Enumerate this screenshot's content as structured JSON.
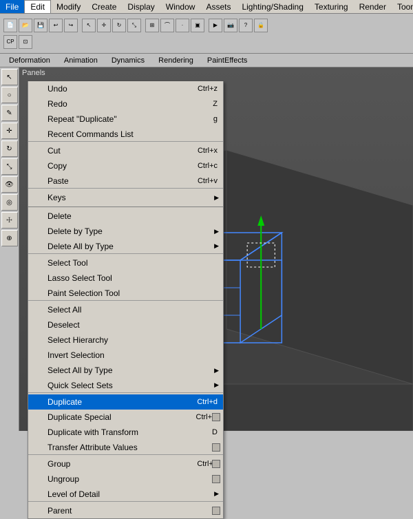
{
  "menubar": {
    "items": [
      {
        "label": "File",
        "id": "file"
      },
      {
        "label": "Edit",
        "id": "edit",
        "active": true
      },
      {
        "label": "Modify",
        "id": "modify"
      },
      {
        "label": "Create",
        "id": "create"
      },
      {
        "label": "Display",
        "id": "display"
      },
      {
        "label": "Window",
        "id": "window"
      },
      {
        "label": "Assets",
        "id": "assets"
      },
      {
        "label": "Lighting/Shading",
        "id": "lighting"
      },
      {
        "label": "Texturing",
        "id": "texturing"
      },
      {
        "label": "Render",
        "id": "render"
      },
      {
        "label": "Toon",
        "id": "toon"
      }
    ]
  },
  "shelf_tabs": [
    {
      "label": "Deformation",
      "active": false
    },
    {
      "label": "Animation",
      "active": false
    },
    {
      "label": "Dynamics",
      "active": false
    },
    {
      "label": "Rendering",
      "active": false
    },
    {
      "label": "PaintEffects",
      "active": false
    }
  ],
  "viewport": {
    "label": "Panels"
  },
  "edit_menu": {
    "items": [
      {
        "id": "undo",
        "label": "Undo",
        "shortcut": "Ctrl+z",
        "type": "normal"
      },
      {
        "id": "redo",
        "label": "Redo",
        "shortcut": "Z",
        "type": "normal"
      },
      {
        "id": "repeat",
        "label": "Repeat \"Duplicate\"",
        "shortcut": "g",
        "type": "normal"
      },
      {
        "id": "recent",
        "label": "Recent Commands List",
        "type": "normal",
        "separator_after": true
      },
      {
        "id": "cut",
        "label": "Cut",
        "shortcut": "Ctrl+x",
        "type": "normal"
      },
      {
        "id": "copy",
        "label": "Copy",
        "shortcut": "Ctrl+c",
        "type": "normal"
      },
      {
        "id": "paste",
        "label": "Paste",
        "shortcut": "Ctrl+v",
        "type": "normal",
        "separator_after": true
      },
      {
        "id": "keys",
        "label": "Keys",
        "type": "submenu"
      },
      {
        "id": "sep1",
        "type": "separator"
      },
      {
        "id": "delete",
        "label": "Delete",
        "type": "normal"
      },
      {
        "id": "delete-by-type",
        "label": "Delete by Type",
        "type": "submenu"
      },
      {
        "id": "delete-all",
        "label": "Delete All by Type",
        "type": "submenu",
        "separator_after": true
      },
      {
        "id": "select-tool",
        "label": "Select Tool",
        "type": "normal"
      },
      {
        "id": "lasso",
        "label": "Lasso Select Tool",
        "type": "normal"
      },
      {
        "id": "paint-select",
        "label": "Paint Selection Tool",
        "type": "normal",
        "separator_after": true
      },
      {
        "id": "select-all",
        "label": "Select All",
        "type": "normal"
      },
      {
        "id": "deselect",
        "label": "Deselect",
        "type": "normal"
      },
      {
        "id": "select-hier",
        "label": "Select Hierarchy",
        "type": "normal"
      },
      {
        "id": "invert",
        "label": "Invert Selection",
        "type": "normal"
      },
      {
        "id": "select-all-type",
        "label": "Select All by Type",
        "type": "submenu"
      },
      {
        "id": "quick-sets",
        "label": "Quick Select Sets",
        "type": "submenu",
        "separator_after": true
      },
      {
        "id": "duplicate",
        "label": "Duplicate",
        "shortcut": "Ctrl+d",
        "type": "highlighted"
      },
      {
        "id": "dup-special",
        "label": "Duplicate Special",
        "shortcut": "Ctrl+D",
        "type": "normal",
        "has_option": true
      },
      {
        "id": "dup-transform",
        "label": "Duplicate with Transform",
        "shortcut": "D",
        "type": "normal"
      },
      {
        "id": "transfer",
        "label": "Transfer Attribute Values",
        "type": "normal",
        "has_option": true,
        "separator_after": true
      },
      {
        "id": "group",
        "label": "Group",
        "shortcut": "Ctrl+g",
        "type": "normal",
        "has_option": true
      },
      {
        "id": "ungroup",
        "label": "Ungroup",
        "type": "normal",
        "has_option": true
      },
      {
        "id": "lod",
        "label": "Level of Detail",
        "type": "submenu",
        "separator_after": true
      },
      {
        "id": "parent",
        "label": "Parent",
        "type": "normal",
        "has_option": true
      }
    ]
  }
}
